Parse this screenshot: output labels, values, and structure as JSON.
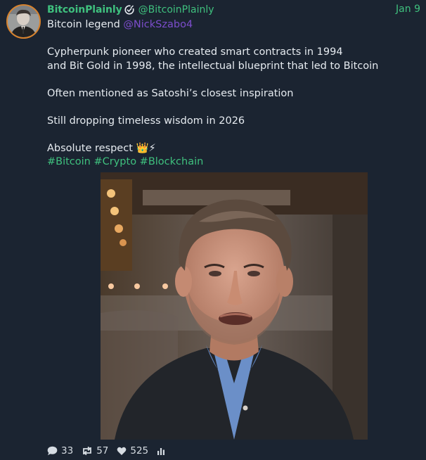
{
  "post": {
    "author": {
      "display_name": "BitcoinPlainly",
      "handle": "@BitcoinPlainly",
      "verified_icon": "verified-check-icon"
    },
    "date": "Jan 9",
    "body": {
      "line1_prefix": "Bitcoin legend ",
      "line1_mention": "@NickSzabo4",
      "line2": "Cypherpunk pioneer who created smart contracts in 1994",
      "line3": "and Bit Gold in 1998, the intellectual blueprint that led to Bitcoin",
      "line4": "Often mentioned as Satoshi’s closest inspiration",
      "line5": "Still dropping timeless wisdom in 2026",
      "line6_text": "Absolute respect ",
      "line6_emoji": "👑⚡",
      "hashtags": [
        "#Bitcoin",
        "#Crypto",
        "#Blockchain"
      ]
    },
    "media": {
      "alt_icon": "photo-portrait-image"
    },
    "stats": {
      "replies": "33",
      "reposts": "57",
      "likes": "525"
    }
  },
  "icons": {
    "reply": "comment-bubble-icon",
    "repost": "repost-icon",
    "like": "heart-icon",
    "views": "bar-chart-icon"
  },
  "colors": {
    "background": "#1b2431",
    "accent_green": "#3fc07e",
    "mention_purple": "#7c4dcc",
    "avatar_ring": "#d9822b"
  }
}
